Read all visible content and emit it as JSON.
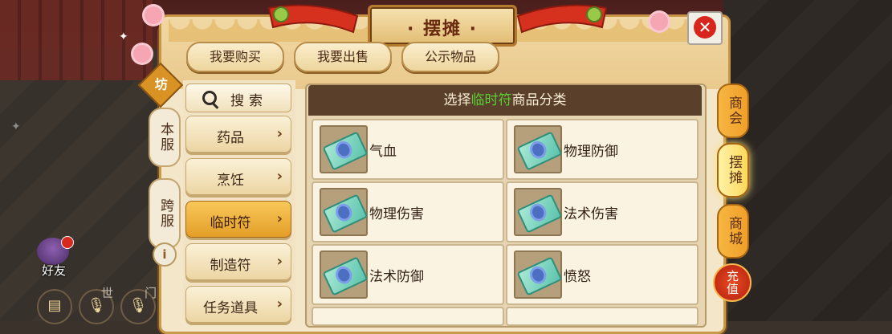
{
  "window": {
    "title": "摆摊",
    "close_label": "✕"
  },
  "top_tabs": [
    {
      "label": "我要购买"
    },
    {
      "label": "我要出售"
    },
    {
      "label": "公示物品"
    }
  ],
  "left_tabs": {
    "badge": "坊",
    "server_local": "本服",
    "server_cross": "跨服",
    "info": "i"
  },
  "categories": {
    "search_label": "搜索",
    "items": [
      {
        "label": "药品",
        "active": false
      },
      {
        "label": "烹饪",
        "active": false
      },
      {
        "label": "临时符",
        "active": true
      },
      {
        "label": "制造符",
        "active": false
      },
      {
        "label": "任务道具",
        "active": false
      }
    ]
  },
  "grid": {
    "header_prefix": "选择",
    "header_highlight": "临时符",
    "header_suffix": "商品分类",
    "items": [
      {
        "name": "气血"
      },
      {
        "name": "物理防御"
      },
      {
        "name": "物理伤害"
      },
      {
        "name": "法术伤害"
      },
      {
        "name": "法术防御"
      },
      {
        "name": "愤怒"
      }
    ]
  },
  "right_tabs": [
    {
      "label": "商会",
      "active": false
    },
    {
      "label": "摆摊",
      "active": true
    },
    {
      "label": "商城",
      "active": false
    },
    {
      "label": "充值",
      "active": false
    }
  ],
  "hud": {
    "friends_label": "好友",
    "world_label": "世",
    "other_label": "门"
  },
  "colors": {
    "accent": "#e49e28",
    "highlight_text": "#5ad034",
    "header_bg": "#5a3f2b",
    "close_red": "#d6261e"
  }
}
